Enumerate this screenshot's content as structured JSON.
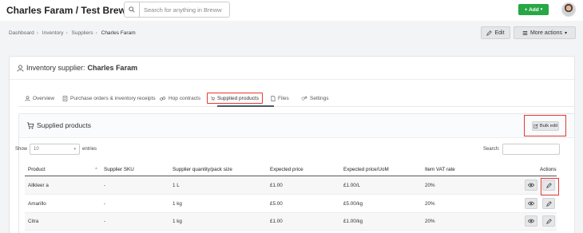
{
  "topbar": {
    "brand": "Charles Faram / Test Brewery",
    "search_placeholder": "Search for anything in Breww",
    "add_label": "+ Add"
  },
  "breadcrumbs": [
    "Dashboard",
    "Inventory",
    "Suppliers",
    "Charles Faram"
  ],
  "header_actions": {
    "edit": "Edit",
    "more": "More actions"
  },
  "supplier": {
    "title_prefix": "Inventory supplier:",
    "name": "Charles Faram"
  },
  "tabs": [
    {
      "label": "Overview",
      "icon": "user-icon"
    },
    {
      "label": "Purchase orders & inventory receipts",
      "icon": "receipt-icon"
    },
    {
      "label": "Hop contracts",
      "icon": "hop-icon"
    },
    {
      "label": "Supplied products",
      "icon": "cart-icon",
      "active": true
    },
    {
      "label": "Files",
      "icon": "file-icon"
    },
    {
      "label": "Settings",
      "icon": "cogs-icon"
    }
  ],
  "supplied": {
    "title": "Supplied products",
    "bulk_edit": "Bulk edit",
    "show_label": "Show",
    "entries_value": "10",
    "entries_label": "entries",
    "search_label": "Search:"
  },
  "table": {
    "columns": [
      "Product",
      "Supplier SKU",
      "Supplier quantity/pack size",
      "Expected price",
      "Expected price/UoM",
      "Item VAT rate",
      "Actions"
    ],
    "rows": [
      {
        "product": "Allkleer a",
        "sku": "-",
        "pack": "1 L",
        "price": "£1.00",
        "uom": "£1.00/L",
        "vat": "20%"
      },
      {
        "product": "Amarillo",
        "sku": "-",
        "pack": "1 kg",
        "price": "£5.00",
        "uom": "£5.00/kg",
        "vat": "20%"
      },
      {
        "product": "Citra",
        "sku": "-",
        "pack": "1 kg",
        "price": "£1.00",
        "uom": "£1.00/kg",
        "vat": "20%"
      }
    ]
  },
  "colors": {
    "accent_green": "#27a745",
    "highlight_red": "#e53935"
  }
}
